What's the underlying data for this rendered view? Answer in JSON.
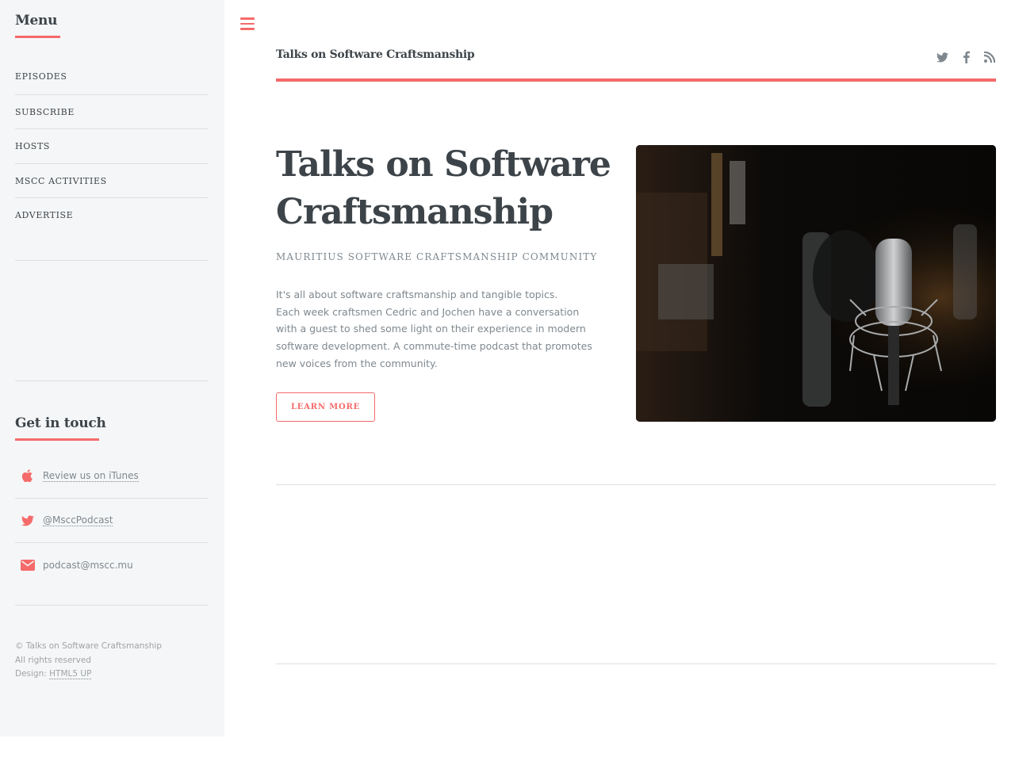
{
  "sidebar": {
    "menu_heading": "Menu",
    "menu_items": [
      {
        "label": "EPISODES"
      },
      {
        "label": "SUBSCRIBE"
      },
      {
        "label": "HOSTS"
      },
      {
        "label": "MSCC ACTIVITIES"
      },
      {
        "label": "ADVERTISE"
      }
    ],
    "contact_heading": "Get in touch",
    "contacts": [
      {
        "icon": "apple-icon",
        "label": "Review us on iTunes"
      },
      {
        "icon": "twitter-icon",
        "label": "@MsccPodcast"
      },
      {
        "icon": "envelope-icon",
        "label": "podcast@mscc.mu"
      }
    ],
    "footer": {
      "copyright": "© Talks on Software Craftsmanship",
      "rights": "All rights reserved",
      "design_prefix": "Design: ",
      "design_link": "HTML5 UP"
    }
  },
  "header": {
    "menu_toggle_icon": "hamburger-icon",
    "site_title": "Talks on Software Craftsmanship",
    "social_icons": [
      "twitter-icon",
      "facebook-icon",
      "rss-icon"
    ]
  },
  "banner": {
    "title": "Talks on Software Craftsmanship",
    "subtitle": "MAURITIUS SOFTWARE CRAFTSMANSHIP COMMUNITY",
    "description_line1": "It's all about software craftsmanship and tangible topics.",
    "description_line2": "Each week craftsmen Cedric and Jochen have a conversation with a guest to shed some light on their experience in modern software development. A commute-time podcast that promotes new voices from the community.",
    "button_label": "LEARN MORE",
    "image": "studio-microphone-photo"
  },
  "colors": {
    "accent": "#f56a6a",
    "heading": "#3d4449",
    "text": "#7f888f",
    "sidebar_bg": "#f5f6f7"
  }
}
